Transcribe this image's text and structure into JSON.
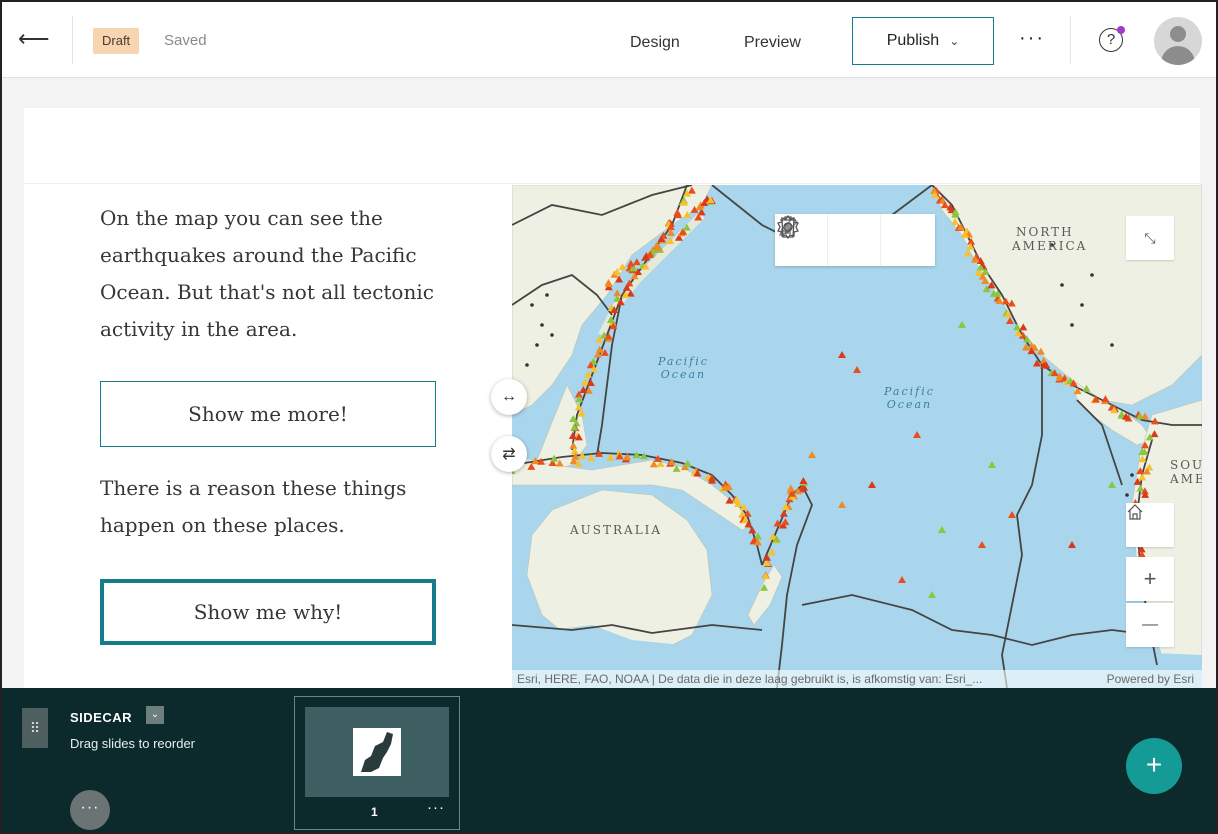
{
  "topbar": {
    "back_icon": "arrow-left-icon",
    "status_badge": "Draft",
    "saved_text": "Saved",
    "nav": {
      "design": "Design",
      "preview": "Preview"
    },
    "publish_label": "Publish",
    "more_glyph": "···",
    "help_glyph": "?",
    "colors": {
      "accent": "#147c8a",
      "draft_bg": "#f7d5b0",
      "notification": "#a23ac9"
    }
  },
  "story": {
    "paragraph_1": "On the map you can see the earthquakes around the Pacific Ocean. But that's not all tectonic activity in the area.",
    "button_more": "Show me more!",
    "paragraph_2": "There is a reason these things happen on these places.",
    "button_why": "Show me why!"
  },
  "map": {
    "labels": {
      "north_america_1": "NORTH",
      "north_america_2": "AMERICA",
      "australia": "AUSTRALIA",
      "south_america_1": "SOUT",
      "south_america_2": "AMER",
      "pacific_west_1": "Pacific",
      "pacific_west_2": "Ocean",
      "pacific_center_1": "Pacific",
      "pacific_center_2": "Ocean"
    },
    "attribution": "Esri, HERE, FAO, NOAA | De data die in deze laag gebruikt is, is afkomstig van: Esri_...",
    "powered_by": "Powered by Esri",
    "controls": {
      "zoom_in": "+",
      "zoom_out": "—"
    },
    "toolbar_icons": [
      "pencil-icon",
      "gear-icon",
      "trash-icon"
    ],
    "colors": {
      "water": "#a9d6ec",
      "land": "#eef0e4",
      "plate_boundary": "#444444"
    }
  },
  "handles": {
    "resize_glyph": "↔",
    "swap_glyph": "⇄"
  },
  "dock": {
    "title": "SIDECAR",
    "subtitle": "Drag slides to reorder",
    "slide_number": "1",
    "slide_more": "···",
    "more_glyph": "···",
    "add_glyph": "+",
    "colors": {
      "background": "#0c2a2b",
      "add_button": "#159b96"
    }
  }
}
